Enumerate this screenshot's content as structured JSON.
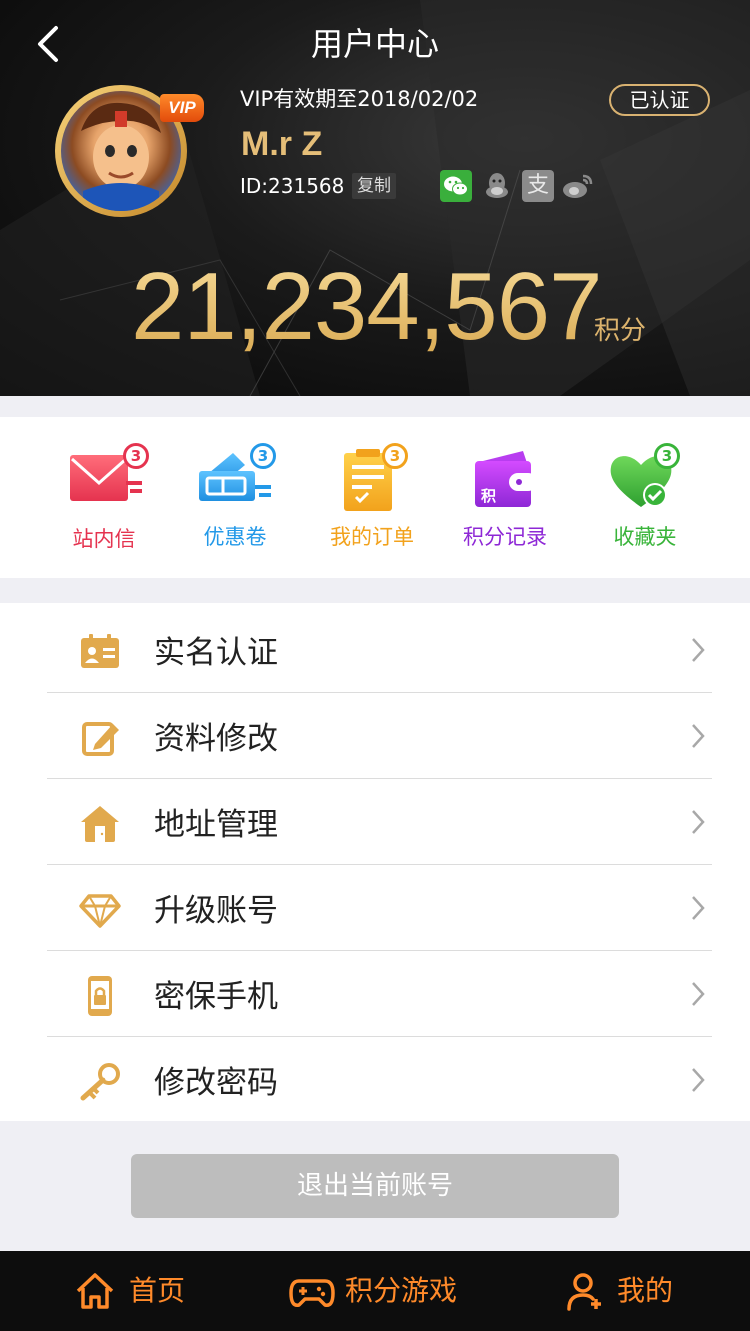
{
  "header": {
    "title": "用户中心",
    "vip_badge": "VIP",
    "vip_expiry": "VIP有效期至2018/02/02",
    "verified": "已认证",
    "user_name": "M.r Z",
    "user_id": "ID:231568",
    "copy_label": "复制",
    "points": "21,234,567",
    "points_unit": "积分",
    "social_icons": [
      "wechat-icon",
      "qq-icon",
      "alipay-icon",
      "weibo-icon"
    ]
  },
  "quick": [
    {
      "label": "站内信",
      "badge": "3",
      "icon": "mail-icon",
      "color": "#e5334f"
    },
    {
      "label": "优惠卷",
      "badge": "3",
      "icon": "coupon-icon",
      "color": "#2399e8"
    },
    {
      "label": "我的订单",
      "badge": "3",
      "icon": "order-icon",
      "color": "#f2a21c"
    },
    {
      "label": "积分记录",
      "badge": "",
      "icon": "wallet-icon",
      "color": "#8e28d6"
    },
    {
      "label": "收藏夹",
      "badge": "3",
      "icon": "favorite-icon",
      "color": "#39b43a"
    }
  ],
  "wallet_char": "积",
  "menu": [
    {
      "label": "实名认证",
      "icon": "id-card-icon"
    },
    {
      "label": "资料修改",
      "icon": "edit-icon"
    },
    {
      "label": "地址管理",
      "icon": "house-icon"
    },
    {
      "label": "升级账号",
      "icon": "diamond-icon"
    },
    {
      "label": "密保手机",
      "icon": "phone-lock-icon"
    },
    {
      "label": "修改密码",
      "icon": "key-icon"
    }
  ],
  "logout_label": "退出当前账号",
  "tabs": [
    {
      "label": "首页",
      "icon": "home-icon"
    },
    {
      "label": "积分游戏",
      "icon": "gamepad-icon"
    },
    {
      "label": "我的",
      "icon": "user-add-icon"
    }
  ],
  "colors": {
    "gold": "#dcb36d",
    "menu_icon": "#e1a94d",
    "tab_active": "#ff8a2a"
  }
}
